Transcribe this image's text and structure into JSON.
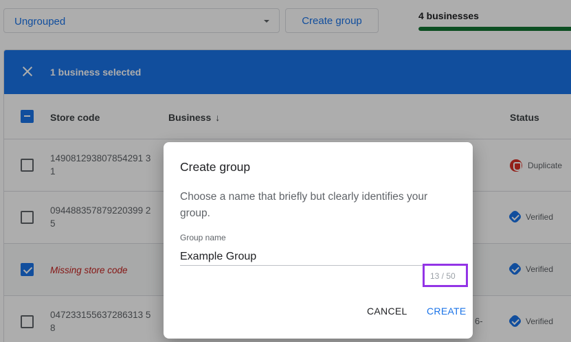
{
  "toolbar": {
    "group_select_value": "Ungrouped",
    "create_group_label": "Create group",
    "business_count_label": "4 businesses",
    "progress_fraction": 1.0
  },
  "selection_bar": {
    "text": "1 business selected"
  },
  "table": {
    "columns": {
      "store_code": "Store code",
      "business": "Business",
      "business_sort_icon": "arrow-down-icon",
      "status": "Status"
    },
    "rows": [
      {
        "store_code": "149081293807854291 31",
        "checked": false,
        "status": "Duplicate",
        "status_icon": "duplicate-icon",
        "business_fragment": ""
      },
      {
        "store_code": "094488357879220399 25",
        "checked": false,
        "status": "Verified",
        "status_icon": "verified-icon",
        "business_fragment": ""
      },
      {
        "store_code": "Missing store code",
        "checked": true,
        "status": "Verified",
        "status_icon": "verified-icon",
        "business_fragment": ""
      },
      {
        "store_code": "047233155637286313 58",
        "checked": false,
        "status": "Verified",
        "status_icon": "verified-icon",
        "business_fragment": "6-"
      }
    ]
  },
  "dialog": {
    "title": "Create group",
    "description": "Choose a name that briefly but clearly identifies your group.",
    "field_label": "Group name",
    "field_value": "Example Group",
    "char_counter": "13 / 50",
    "cancel_label": "CANCEL",
    "create_label": "CREATE"
  },
  "colors": {
    "primary": "#1a73e8",
    "progress": "#137333",
    "duplicate": "#d93025",
    "highlight_box": "#9334e6",
    "missing_text": "#c5221f"
  }
}
